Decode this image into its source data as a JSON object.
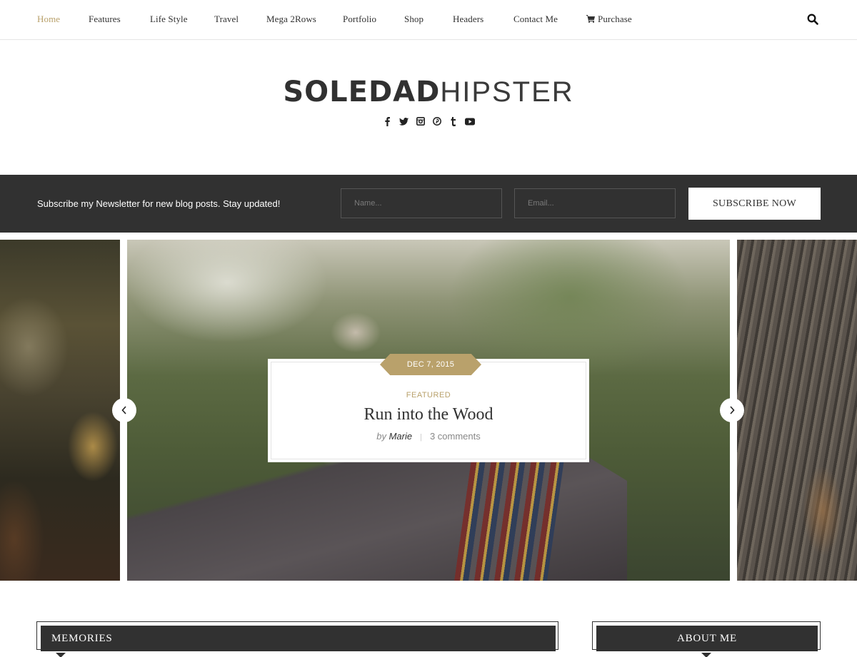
{
  "nav": {
    "items": [
      {
        "label": "Home",
        "active": true
      },
      {
        "label": "Features"
      },
      {
        "label": "Life Style"
      },
      {
        "label": "Travel"
      },
      {
        "label": "Mega 2Rows"
      },
      {
        "label": "Portfolio"
      },
      {
        "label": "Shop"
      },
      {
        "label": "Headers"
      },
      {
        "label": "Contact Me"
      },
      {
        "label": "Purchase",
        "icon": "cart-icon"
      }
    ],
    "search_icon": "search-icon"
  },
  "logo": {
    "bold": "SOLEDAD",
    "light": "HIPSTER"
  },
  "socials": [
    "facebook-icon",
    "twitter-icon",
    "instagram-icon",
    "pinterest-icon",
    "tumblr-icon",
    "youtube-icon"
  ],
  "newsletter": {
    "text": "Subscribe my Newsletter for new blog posts. Stay updated!",
    "name_placeholder": "Name...",
    "email_placeholder": "Email...",
    "submit_label": "SUBSCRIBE NOW"
  },
  "slider": {
    "featured": {
      "date": "DEC 7, 2015",
      "category": "FEATURED",
      "title": "Run into the Wood",
      "by": "by",
      "author": "Marie",
      "separator": "|",
      "comments": "3 comments"
    }
  },
  "widgets": {
    "memories": "MEMORIES",
    "about": "ABOUT ME"
  },
  "colors": {
    "accent": "#b9a16b",
    "dark": "#313131"
  }
}
